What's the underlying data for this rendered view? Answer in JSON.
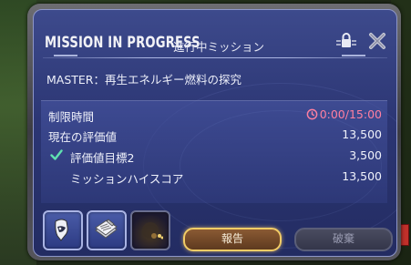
{
  "window": {
    "title": "MISSION IN PROGRESS",
    "subtitle": "進行中ミッション",
    "lock_icon": "lock-icon",
    "close_icon": "close-icon"
  },
  "master": {
    "text": "MASTER：再生エネルギー燃料の探究"
  },
  "stats": {
    "time_limit": {
      "label": "制限時間",
      "value": "0:00/15:00",
      "icon": "clock-icon",
      "color": "#ff7fa0"
    },
    "current_score": {
      "label": "現在の評価値",
      "value": "13,500"
    },
    "target_2": {
      "label": "評価値目標2",
      "value": "3,500",
      "icon": "check-icon",
      "color": "#5fe0b0"
    },
    "high_score": {
      "label": "ミッションハイスコア",
      "value": "13,500"
    }
  },
  "buttons": {
    "report": "報告",
    "dismiss": "破棄"
  },
  "colors": {
    "panel": "#2c3674",
    "report_border": "#f2cc66"
  }
}
